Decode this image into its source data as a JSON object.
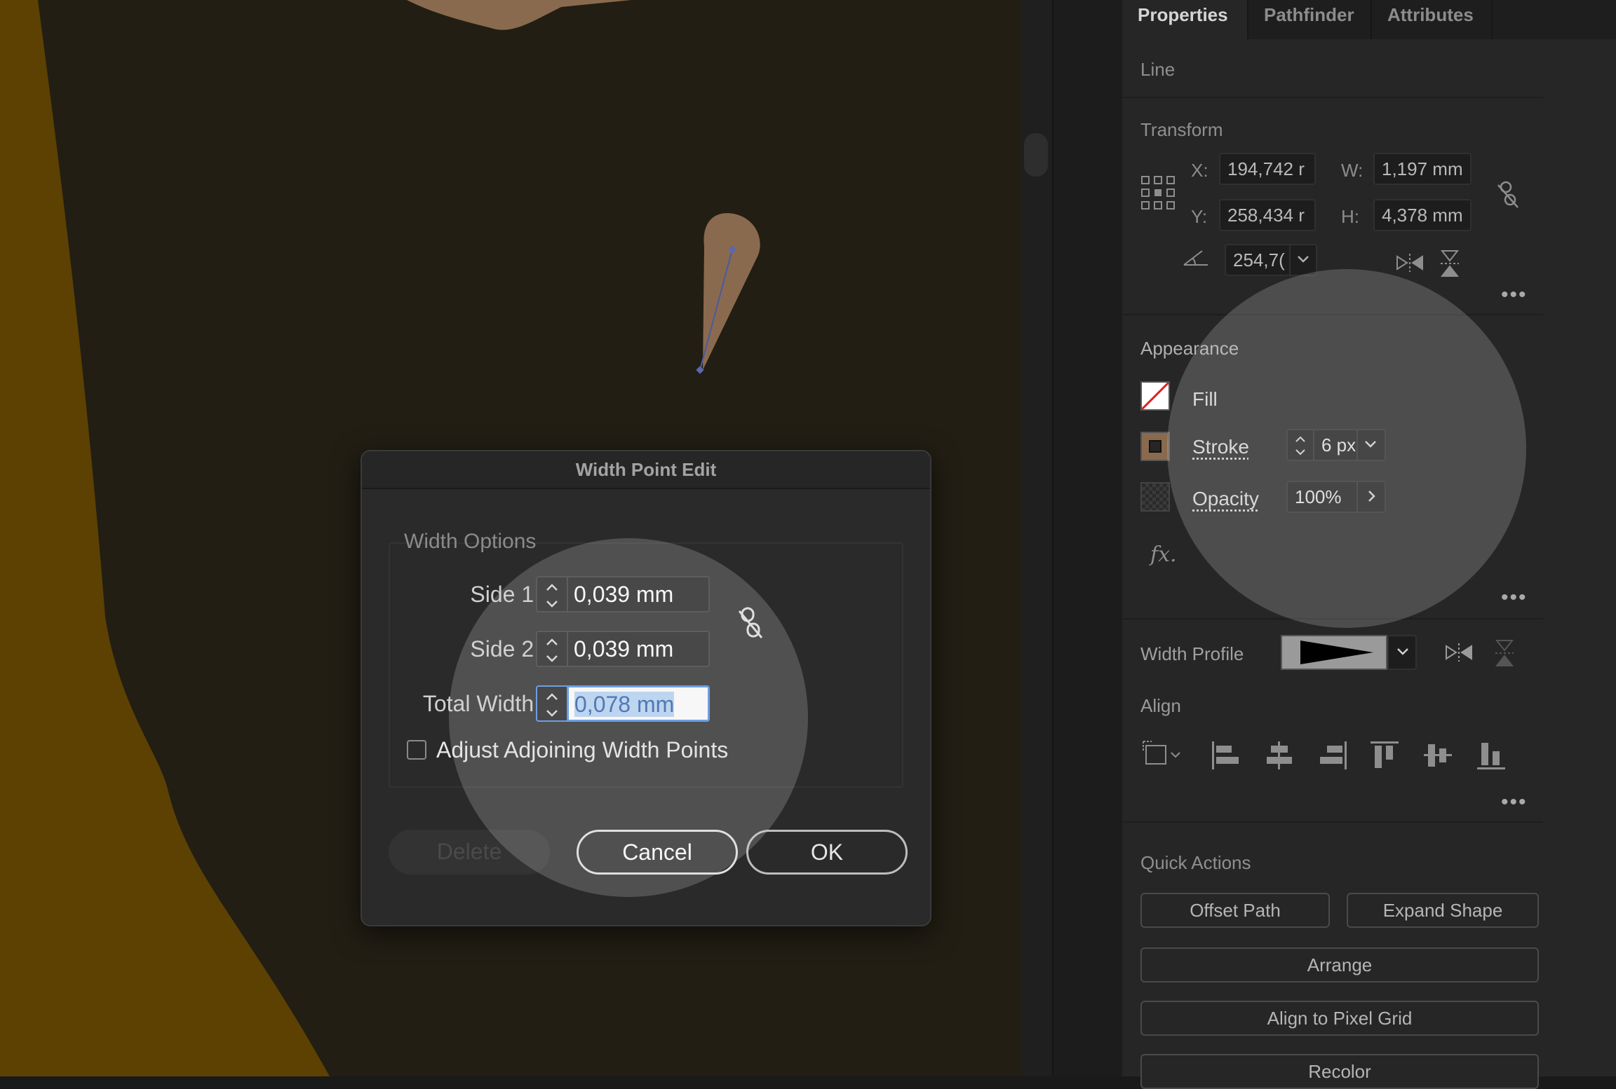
{
  "panel": {
    "tabs": [
      {
        "label": "Properties"
      },
      {
        "label": "Pathfinder"
      },
      {
        "label": "Attributes"
      }
    ],
    "object_type": "Line",
    "transform": {
      "title": "Transform",
      "x_label": "X:",
      "x_value": "194,742 r",
      "y_label": "Y:",
      "y_value": "258,434 r",
      "w_label": "W:",
      "w_value": "1,197 mm",
      "h_label": "H:",
      "h_value": "4,378 mm",
      "angle_value": "254,7("
    },
    "appearance": {
      "title": "Appearance",
      "fill_label": "Fill",
      "stroke_label": "Stroke",
      "stroke_value": "6 px",
      "opacity_label": "Opacity",
      "opacity_value": "100%",
      "fx_label": "fx."
    },
    "width_profile": {
      "label": "Width Profile"
    },
    "align": {
      "title": "Align"
    },
    "quick_actions": {
      "title": "Quick Actions",
      "offset_path": "Offset Path",
      "expand_shape": "Expand Shape",
      "arrange": "Arrange",
      "align_pixel_grid": "Align to Pixel Grid",
      "recolor": "Recolor"
    },
    "more_glyph": "•••"
  },
  "dialog": {
    "title": "Width Point Edit",
    "group_title": "Width Options",
    "side1_label": "Side 1:",
    "side1_value": "0,039 mm",
    "side2_label": "Side 2:",
    "side2_value": "0,039 mm",
    "total_label": "Total Width:",
    "total_value": "0,078 mm",
    "adjust_label": "Adjust Adjoining Width Points",
    "adjust_checked": false,
    "delete_label": "Delete",
    "cancel_label": "Cancel",
    "ok_label": "OK"
  },
  "colors": {
    "canvas_bg": "#221e14",
    "ochre_shape": "#5c4102",
    "stroke_brown": "#8a6a4e",
    "panel_bg": "#262626",
    "focus_blue": "#4d8fe6"
  }
}
